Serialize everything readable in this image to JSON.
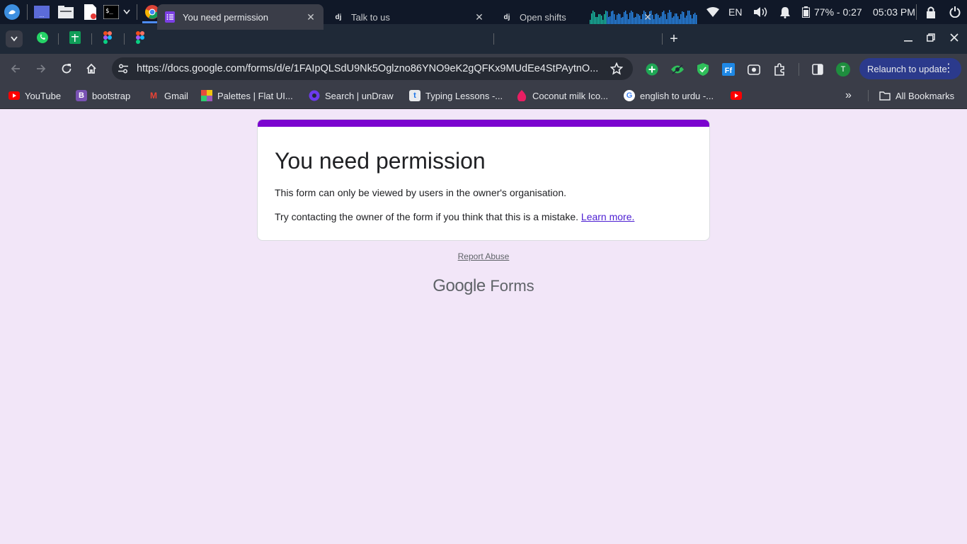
{
  "taskbar": {
    "apps": [
      {
        "name": "start-menu-icon"
      },
      {
        "name": "desktop-icon"
      },
      {
        "name": "file-manager-icon"
      },
      {
        "name": "text-editor-icon"
      },
      {
        "name": "terminal-icon"
      },
      {
        "name": "chrome-icon"
      },
      {
        "name": "vscode-icon"
      }
    ],
    "language": "EN",
    "battery": "77% - 0:27",
    "clock": "05:03 PM"
  },
  "tabs": [
    {
      "title": "You need permission",
      "active": true,
      "icon": "forms-icon"
    },
    {
      "title": "Talk to us",
      "active": false,
      "icon": "django-icon"
    },
    {
      "title": "Open shifts",
      "active": false,
      "icon": "django-icon"
    }
  ],
  "pinned_tabs": [
    "whatsapp-icon",
    "sheets-icon",
    "figma-icon",
    "figma-icon"
  ],
  "omnibox": {
    "url": "https://docs.google.com/forms/d/e/1FAIpQLSdU9Nk5Oglzno86YNO9eK2gQFKx9MUdEe4StPAytnO..."
  },
  "toolbar": {
    "relaunch_label": "Relaunch to update",
    "profile_initial": "T"
  },
  "bookmarks": [
    {
      "label": "YouTube",
      "icon": "youtube-icon"
    },
    {
      "label": "bootstrap",
      "icon": "bootstrap-icon",
      "glyph": "B"
    },
    {
      "label": "Gmail",
      "icon": "gmail-icon",
      "glyph": "M"
    },
    {
      "label": "Palettes | Flat UI...",
      "icon": "palettes-icon"
    },
    {
      "label": "Search | unDraw",
      "icon": "undraw-icon"
    },
    {
      "label": "Typing Lessons -...",
      "icon": "typing-icon",
      "glyph": "t"
    },
    {
      "label": "Coconut milk Ico...",
      "icon": "icons8-icon"
    },
    {
      "label": "english to urdu -...",
      "icon": "google-icon",
      "glyph": "G"
    }
  ],
  "all_bookmarks_label": "All Bookmarks",
  "page": {
    "heading": "You need permission",
    "line1": "This form can only be viewed by users in the owner's organisation.",
    "line2": "Try contacting the owner of the form if you think that this is a mistake.",
    "learn_more": "Learn more.",
    "report_abuse": "Report Abuse",
    "brand_google": "Google",
    "brand_forms": "Forms"
  },
  "colors": {
    "accent": "#7b04cf",
    "page_bg": "#f2e6f8",
    "link": "#4c1ed2",
    "relaunch_bg": "#2b3a8c"
  }
}
